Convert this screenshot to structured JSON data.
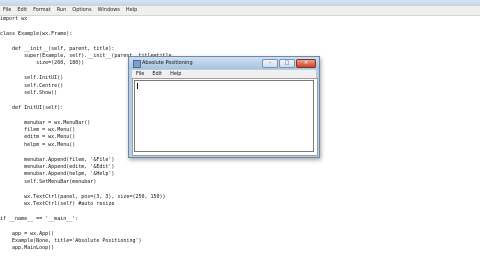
{
  "editor": {
    "menu": [
      "File",
      "Edit",
      "Format",
      "Run",
      "Options",
      "Windows",
      "Help"
    ],
    "code_lines": [
      "import wx",
      "",
      "class Example(wx.Frame):",
      "",
      "    def __init__(self, parent, title):",
      "        super(Example, self).__init__(parent, title=title,",
      "            size=(260, 180))",
      "",
      "        self.InitUI()",
      "        self.Centre()",
      "        self.Show()",
      "",
      "    def InitUI(self):",
      "",
      "        menubar = wx.MenuBar()",
      "        filem = wx.Menu()",
      "        editm = wx.Menu()",
      "        helpm = wx.Menu()",
      "",
      "        menubar.Append(filem, '&File')",
      "        menubar.Append(editm, '&Edit')",
      "        menubar.Append(helpm, '&Help')",
      "        self.SetMenuBar(menubar)",
      "",
      "        wx.TextCtrl(panel, pos=(3, 3), size=(250, 150))",
      "        wx.TextCtrl(self) #auto resize",
      "",
      "if __name__ == '__main__':",
      "",
      "    app = wx.App()",
      "    Example(None, title='Absolute Positioning')",
      "    app.MainLoop()"
    ]
  },
  "wx_window": {
    "title": "Absolute Positioning",
    "menu": [
      "File",
      "Edit",
      "Help"
    ],
    "controls": {
      "minimize": "–",
      "maximize": "□",
      "close": "✕"
    }
  }
}
